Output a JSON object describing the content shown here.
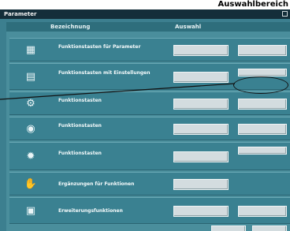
{
  "header_text": "Auswahlbereich",
  "window": {
    "title": "Parameter"
  },
  "columns": {
    "name": "Bezeichnung",
    "select": "Auswahl"
  },
  "rows": [
    {
      "icon": "archive-icon",
      "label": "Funktionstasten für Parameter",
      "buttons": [
        "",
        ""
      ]
    },
    {
      "icon": "doc-icon",
      "label": "Funktionstasten mit Einstellungen",
      "buttons": [
        "",
        ""
      ]
    },
    {
      "icon": "gear-icon",
      "label": "Funktionstasten",
      "buttons": [
        "",
        ""
      ]
    },
    {
      "icon": "eye-icon",
      "label": "Funktionstasten",
      "buttons": [
        "",
        ""
      ]
    },
    {
      "icon": "tool-icon",
      "label": "Funktionstasten",
      "buttons": [
        "",
        ""
      ]
    },
    {
      "icon": "hand-icon",
      "label": "Ergänzungen für Funktionen",
      "buttons": [
        ""
      ]
    },
    {
      "icon": "grid-icon",
      "label": "Erweiterungsfunktionen",
      "buttons": [
        "",
        ""
      ]
    }
  ],
  "footer_buttons": [
    "",
    ""
  ]
}
